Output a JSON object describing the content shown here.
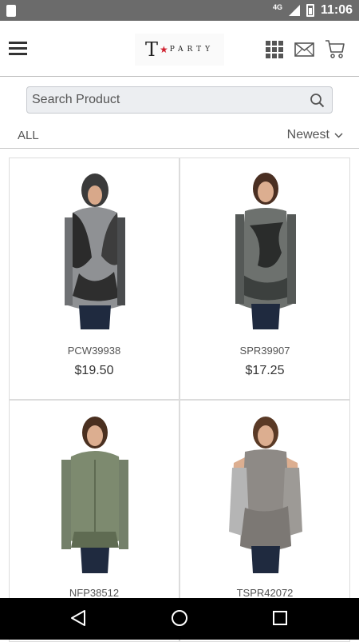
{
  "status_bar": {
    "network": "4G",
    "time": "11:06"
  },
  "header": {
    "logo_letter": "T",
    "logo_word": "PARTY"
  },
  "search": {
    "placeholder": "Search Product"
  },
  "filter": {
    "category": "ALL",
    "sort": "Newest"
  },
  "products": [
    {
      "code": "PCW39938",
      "price": "$19.50"
    },
    {
      "code": "SPR39907",
      "price": "$17.25"
    },
    {
      "code": "NFP38512",
      "price": ""
    },
    {
      "code": "TSPR42072",
      "price": ""
    }
  ],
  "colors": {
    "brand_star": "#d0202f",
    "status_bar": "#6b6b6b",
    "nav_bar": "#000000"
  },
  "icons": [
    "menu-icon",
    "grid-icon",
    "mail-icon",
    "cart-icon",
    "search-icon",
    "chevron-down-icon",
    "back-icon",
    "home-icon",
    "recents-icon"
  ]
}
